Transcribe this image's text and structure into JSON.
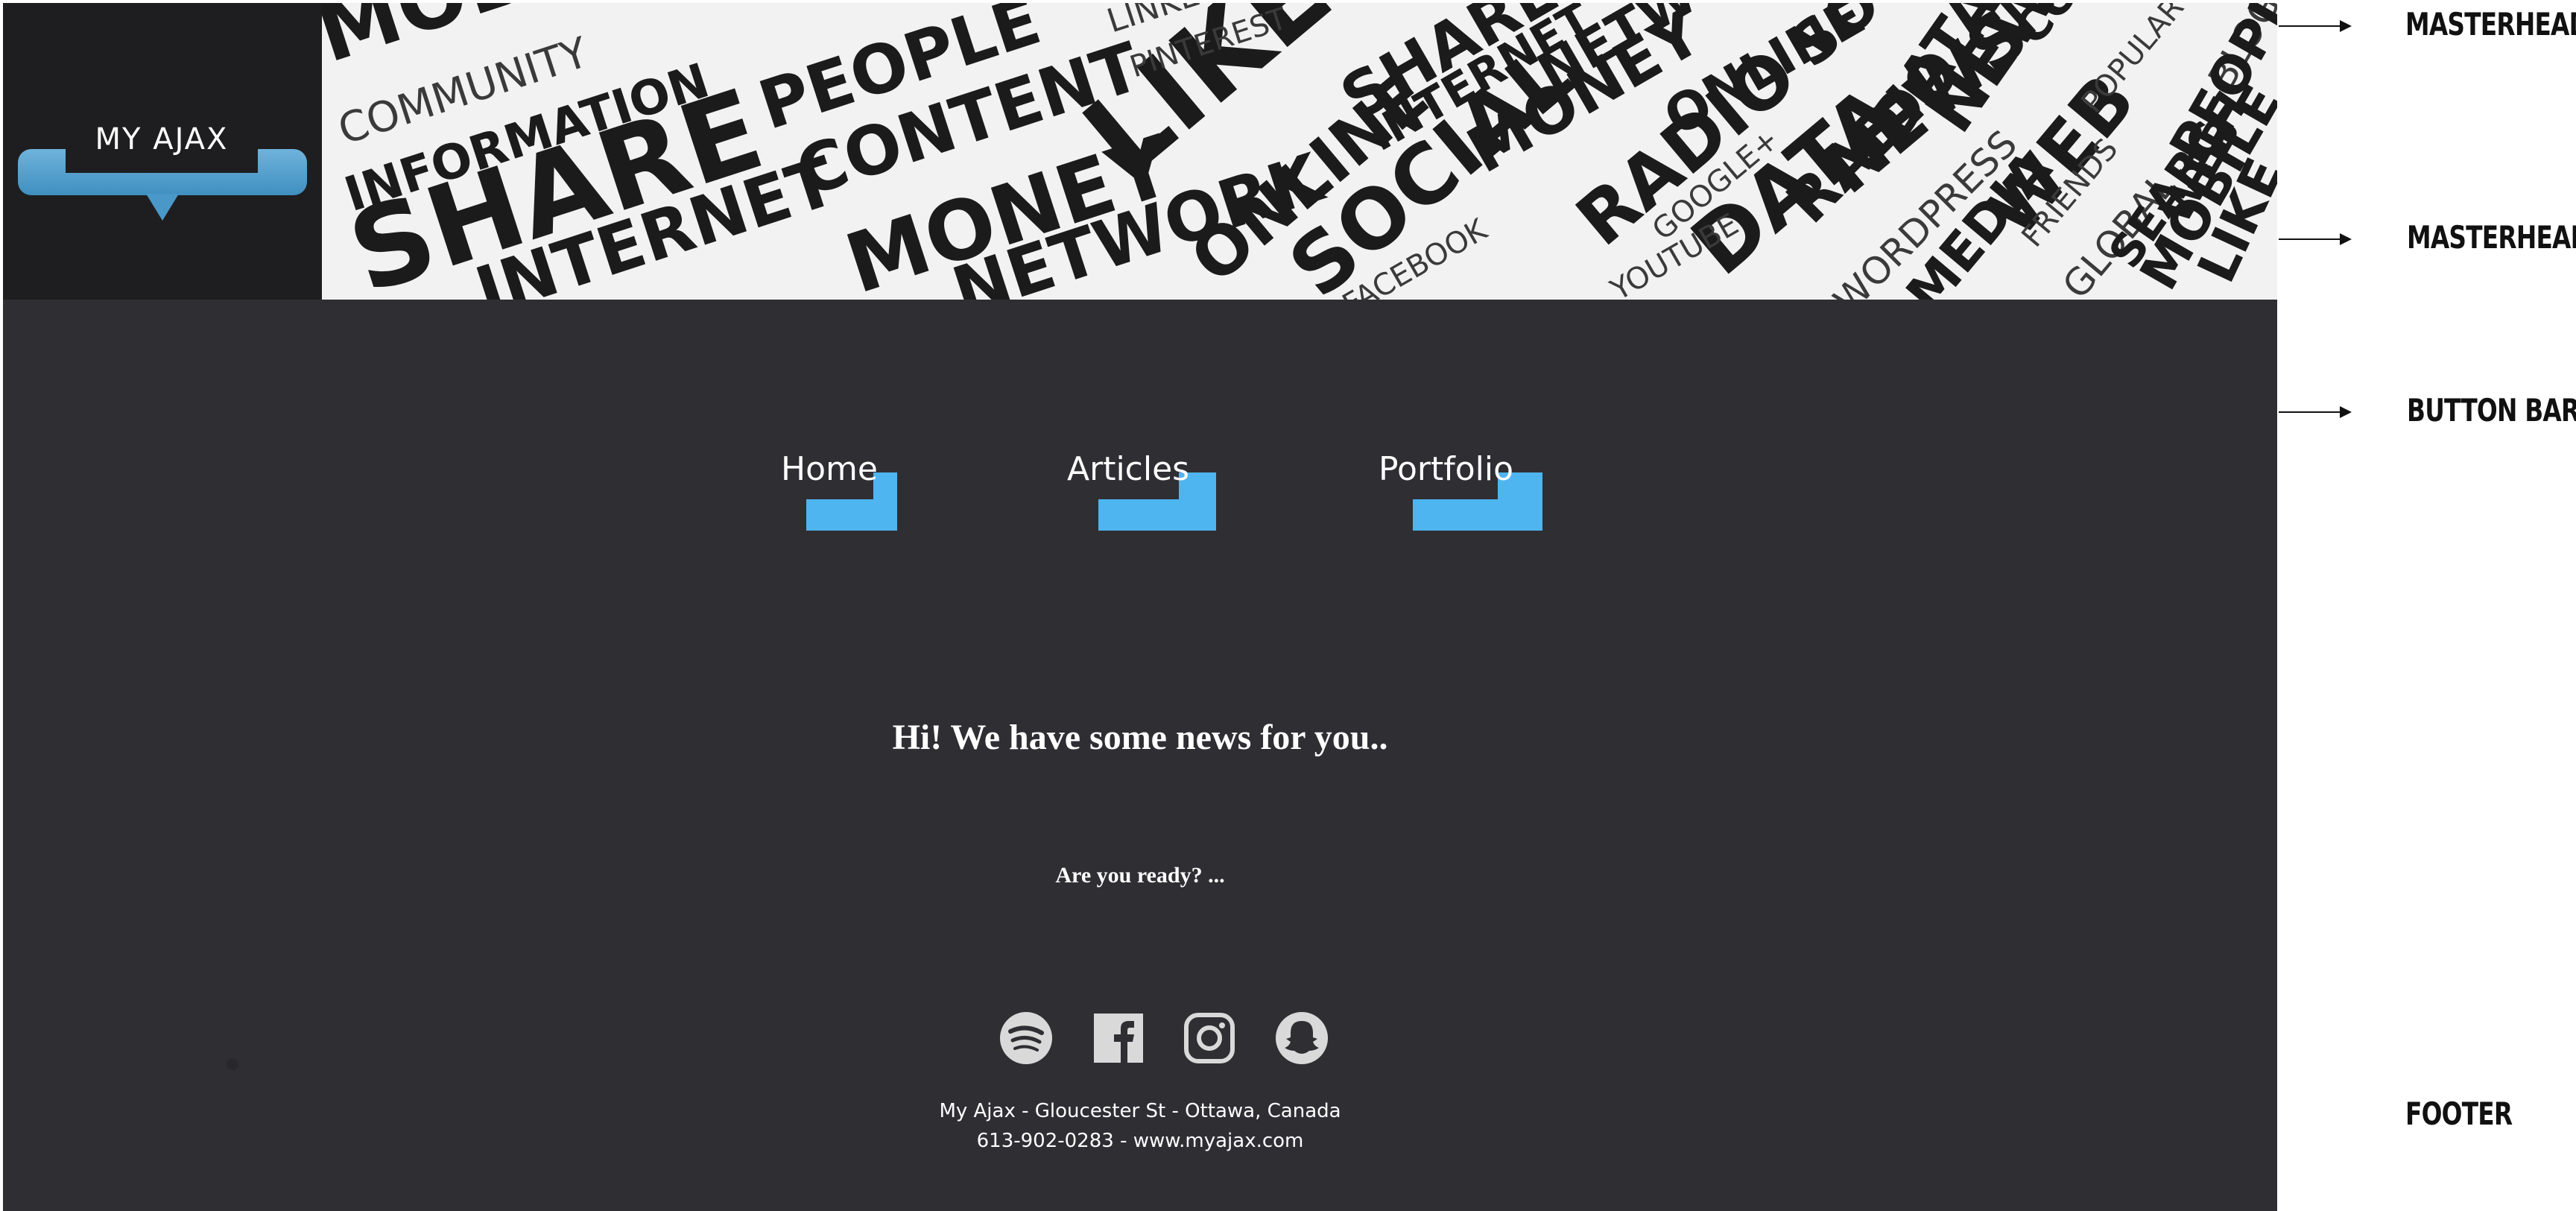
{
  "masthead": {
    "logo_text": "MY AJAX",
    "cloud_words": [
      "MOBILE",
      "COMMUNITY",
      "INFORMATION",
      "SHARE",
      "INTERNET",
      "PEOPLE",
      "CONTENT",
      "MONEY",
      "NETWORK",
      "LIKE",
      "ONLINE",
      "SOCIAL",
      "LINKEDIN",
      "PINTEREST",
      "SHARE",
      "INTERNET",
      "MONEY",
      "RADIO",
      "DATA",
      "NEWS",
      "NETWORK",
      "ONLINE",
      "SOCIAL",
      "YOUTUBE",
      "GOOGLE+",
      "FACEBOOK",
      "WEB",
      "MEDIA",
      "GLOBAL",
      "FRIENDS",
      "SEARCH",
      "MOBILE",
      "POPULAR",
      "DATA",
      "NEWS",
      "RADIO",
      "CONTENT",
      "WORDPRESS",
      "BLOG",
      "PEOPLE",
      "LIKE",
      "WEB"
    ]
  },
  "nav": {
    "items": [
      {
        "label": "Home"
      },
      {
        "label": "Articles"
      },
      {
        "label": "Portfolio"
      }
    ]
  },
  "main": {
    "headline": "Hi! We have some news for you..",
    "subline": "Are you ready? ..."
  },
  "footer": {
    "social": [
      "spotify-icon",
      "facebook-icon",
      "instagram-icon",
      "snapchat-icon"
    ],
    "address": "My Ajax - Gloucester St - Ottawa, Canada",
    "contact": "613-902-0283 - www.myajax.com"
  },
  "annotations": [
    "MASTERHEAD",
    "MASTERHEAD",
    "BUTTON BAR",
    "FOOTER"
  ],
  "colors": {
    "background": "#2f2e33",
    "accent": "#4fb5f0",
    "logo_bar": "#4a98c8"
  }
}
